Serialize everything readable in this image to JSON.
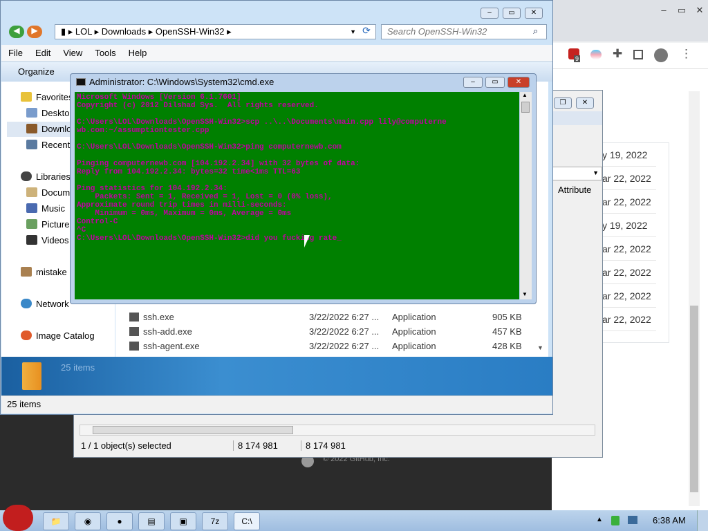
{
  "explorer": {
    "address": [
      "LOL",
      "Downloads",
      "OpenSSH-Win32"
    ],
    "search_placeholder": "Search OpenSSH-Win32",
    "menu": [
      "File",
      "Edit",
      "View",
      "Tools",
      "Help"
    ],
    "organize": "Organize",
    "nav": [
      "Favorites",
      "Desktop",
      "Downloads",
      "Recent",
      "Libraries",
      "Documents",
      "Music",
      "Pictures",
      "Videos",
      "mistake",
      "Network",
      "Image Catalog"
    ],
    "files": [
      {
        "name": "ssh.exe",
        "date": "3/22/2022 6:27 ...",
        "type": "Application",
        "size": "905 KB"
      },
      {
        "name": "ssh-add.exe",
        "date": "3/22/2022 6:27 ...",
        "type": "Application",
        "size": "457 KB"
      },
      {
        "name": "ssh-agent.exe",
        "date": "3/22/2022 6:27 ...",
        "type": "Application",
        "size": "428 KB"
      }
    ],
    "details_count": "25 items",
    "status": "25 items"
  },
  "explorer2": {
    "column": "Attribute",
    "status_selected": "1 / 1 object(s) selected",
    "size1": "8 174 981",
    "size2": "8 174 981"
  },
  "chrome": {
    "dates": [
      "y 19, 2022",
      "ar 22, 2022",
      "ar 22, 2022",
      "y 19, 2022",
      "ar 22, 2022",
      "ar 22, 2022",
      "ar 22, 2022",
      "ar 22, 2022"
    ],
    "footer": "© 2022 GitHub, Inc.",
    "badge": "9"
  },
  "cmd": {
    "title": "Administrator: C:\\Windows\\System32\\cmd.exe",
    "lines": [
      "Microsoft Windows [Version 6.1.7601]",
      "Copyright (c) 2012 Dilshad Sys.  All rights reserved.",
      "",
      "C:\\Users\\LOL\\Downloads\\OpenSSH-Win32>scp ..\\..\\Documents\\main.cpp lily@computerne",
      "wb.com:~/assumptiontester.cpp",
      "",
      "C:\\Users\\LOL\\Downloads\\OpenSSH-Win32>ping computernewb.com",
      "",
      "Pinging computernewb.com [104.192.2.34] with 32 bytes of data:",
      "Reply from 104.192.2.34: bytes=32 time<1ms TTL=63",
      "",
      "Ping statistics for 104.192.2.34:",
      "    Packets: Sent = 1, Received = 1, Lost = 0 (0% loss),",
      "Approximate round trip times in milli-seconds:",
      "    Minimum = 0ms, Maximum = 0ms, Average = 0ms",
      "Control-C",
      "^C",
      "C:\\Users\\LOL\\Downloads\\OpenSSH-Win32>did you fucking rate_"
    ]
  },
  "taskbar": {
    "clock": "6:38 AM"
  }
}
